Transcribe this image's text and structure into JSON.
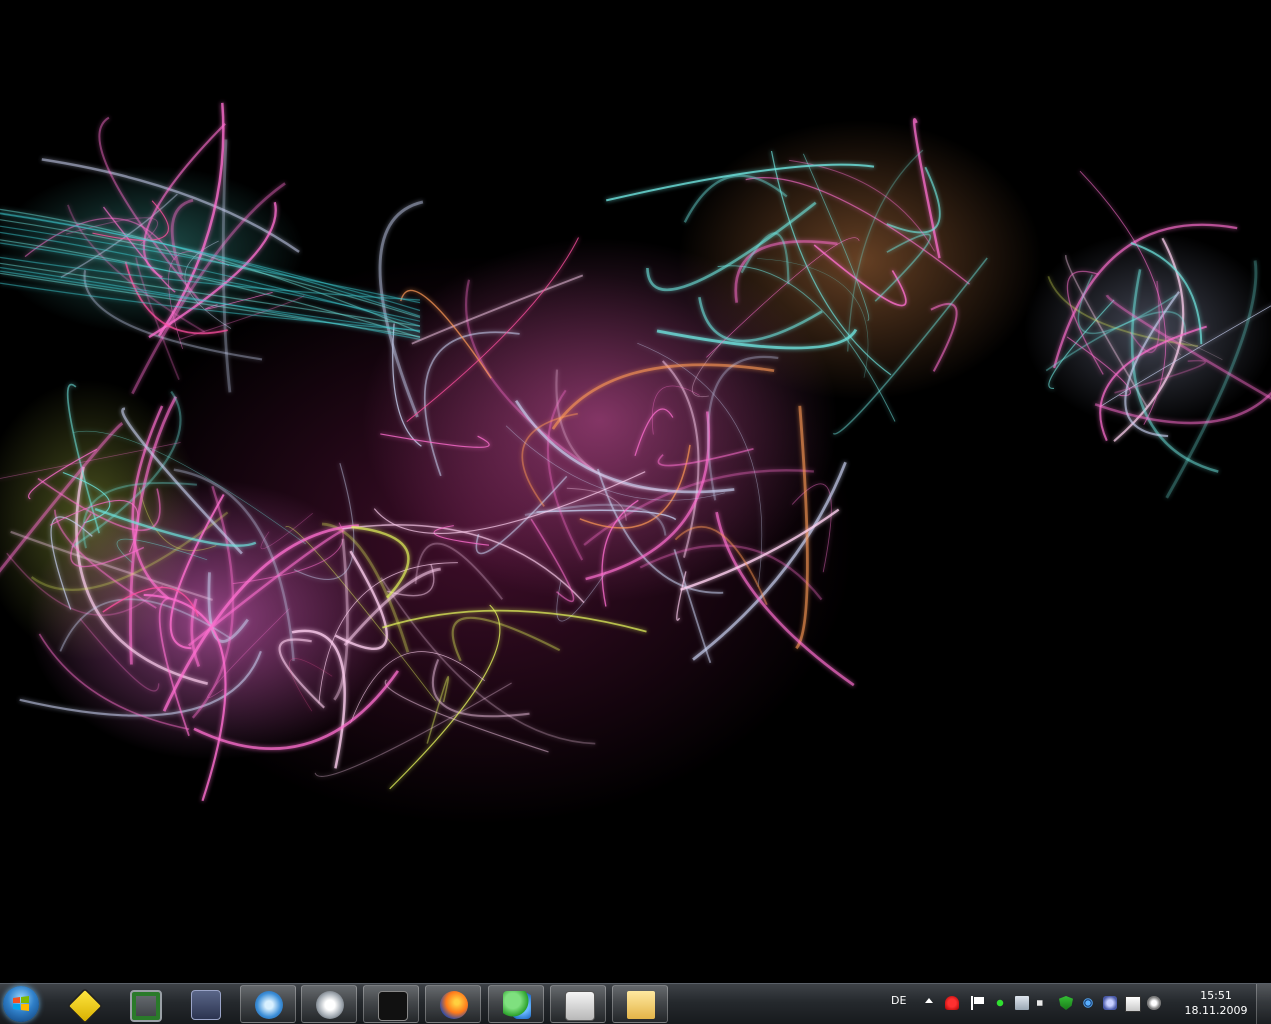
{
  "desktop": {
    "wallpaper": "abstract-fractal-flame-wallpaper",
    "colors": {
      "background": "#000000",
      "pink": "#ff6fd0",
      "orange": "#ff9a55",
      "cyan": "#6fe6e0",
      "yellow": "#e0f05a",
      "silver": "#c8d0f0"
    }
  },
  "taskbar": {
    "start_button": {
      "icon": "windows-logo"
    },
    "buttons": [
      {
        "id": "update",
        "icon": "yellow-arrow-sign-icon",
        "state": "pinned"
      },
      {
        "id": "monitor",
        "icon": "monitor-terminal-icon",
        "state": "pinned"
      },
      {
        "id": "teamspeak",
        "icon": "teamspeak-icon",
        "state": "pinned"
      },
      {
        "id": "itunes",
        "icon": "itunes-icon",
        "state": "running"
      },
      {
        "id": "headset",
        "icon": "headset-icon",
        "state": "running"
      },
      {
        "id": "steam",
        "icon": "steam-icon",
        "state": "running"
      },
      {
        "id": "firefox",
        "icon": "firefox-icon",
        "state": "running"
      },
      {
        "id": "messenger",
        "icon": "messenger-icon",
        "state": "running"
      },
      {
        "id": "xfire",
        "icon": "xfire-icon",
        "state": "running"
      },
      {
        "id": "explorer",
        "icon": "folder-icon",
        "state": "running"
      }
    ],
    "tray": {
      "language": "DE",
      "icons": [
        "antivirus-umbrella-icon",
        "action-center-flag-icon",
        "network-share-icon",
        "network-monitor-icon",
        "volume-icon",
        "security-shield-icon",
        "wireless-icon",
        "headset-tray-icon",
        "xfire-tray-icon",
        "steam-tray-icon"
      ],
      "clock": {
        "time": "15:51",
        "date": "18.11.2009"
      }
    }
  }
}
